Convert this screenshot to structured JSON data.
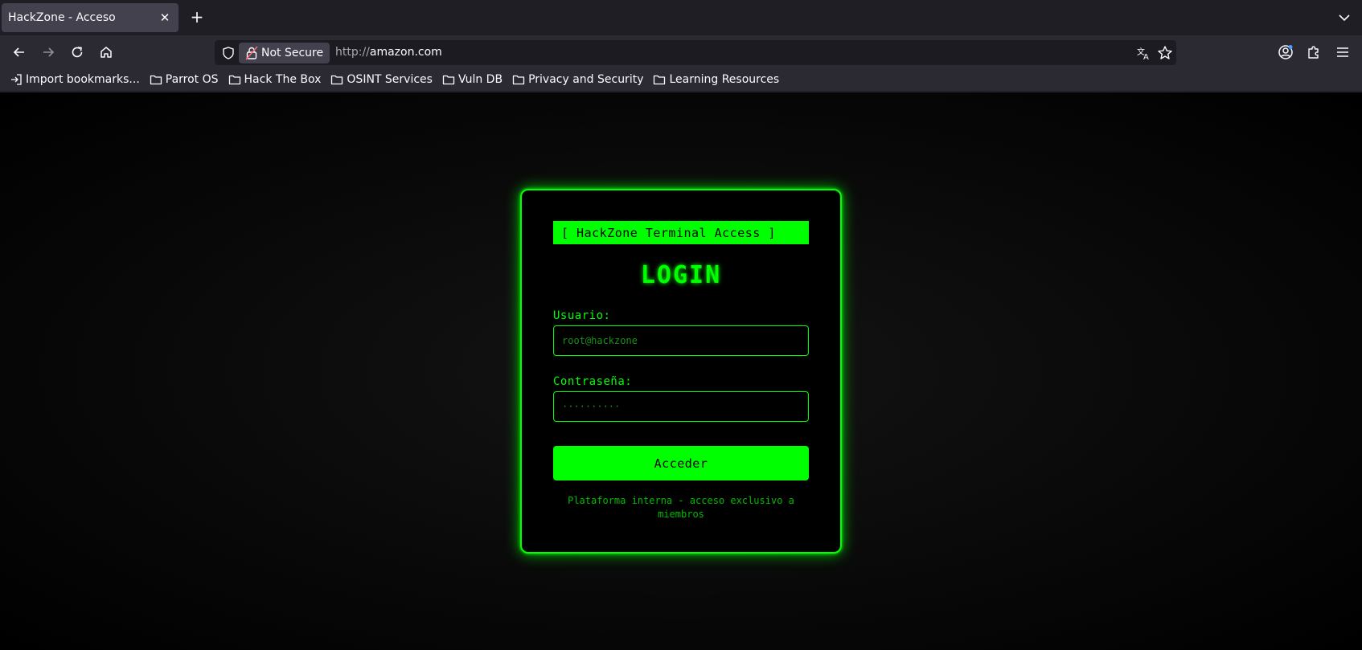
{
  "browser": {
    "tab": {
      "title": "HackZone - Acceso",
      "close": "✕"
    },
    "newtab": "+",
    "urlbar": {
      "security_label": "Not Secure",
      "scheme": "http://",
      "host": "amazon.com"
    },
    "bookmarks": [
      {
        "label": "Import bookmarks...",
        "icon": "import-icon"
      },
      {
        "label": "Parrot OS",
        "icon": "folder-icon"
      },
      {
        "label": "Hack The Box",
        "icon": "folder-icon"
      },
      {
        "label": "OSINT Services",
        "icon": "folder-icon"
      },
      {
        "label": "Vuln DB",
        "icon": "folder-icon"
      },
      {
        "label": "Privacy and Security",
        "icon": "folder-icon"
      },
      {
        "label": "Learning Resources",
        "icon": "folder-icon"
      }
    ]
  },
  "page": {
    "header": "[ HackZone Terminal Access ]",
    "title": "LOGIN",
    "username": {
      "label": "Usuario:",
      "placeholder": "root@hackzone"
    },
    "password": {
      "label": "Contraseña:",
      "placeholder": "··········"
    },
    "submit": "Acceder",
    "footer": "Plataforma interna - acceso exclusivo a miembros"
  },
  "colors": {
    "accent": "#00ff00",
    "background": "#000000",
    "chrome": "#2b2a33"
  }
}
